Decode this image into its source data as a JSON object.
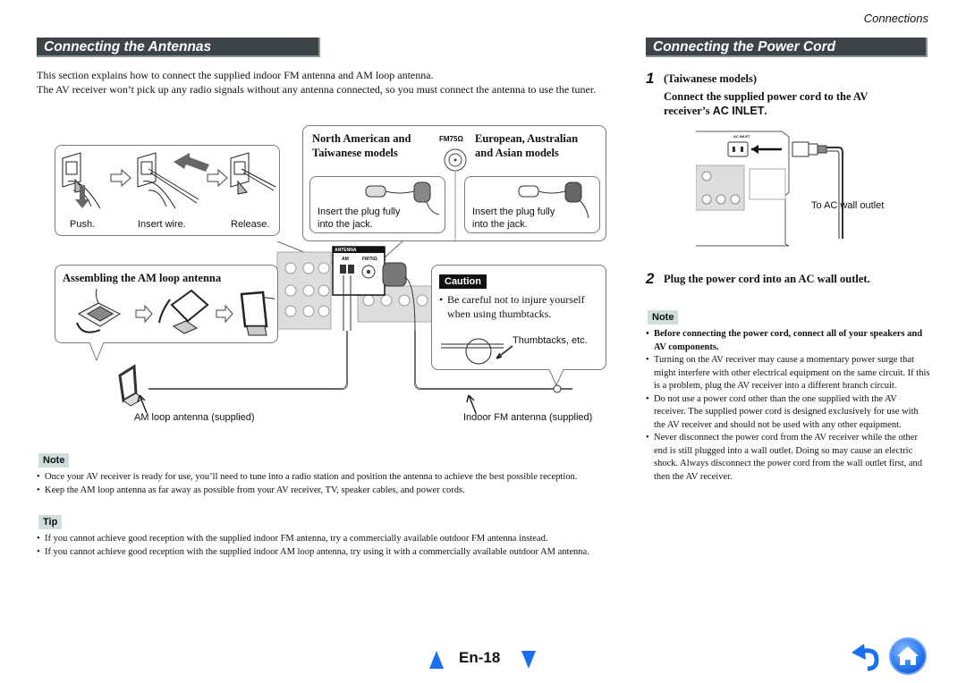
{
  "running_head": "Connections",
  "antennas": {
    "title": "Connecting the Antennas",
    "intro": [
      "This section explains how to connect the supplied indoor FM antenna and AM loop antenna.",
      "The AV receiver won’t pick up any radio signals without any antenna connected, so you must connect the antenna to use the tuner."
    ],
    "am_terminal_steps": [
      "Push.",
      "Insert wire.",
      "Release."
    ],
    "fm_jack_label": "FM75Ω",
    "region_left": {
      "title_line1": "North American and",
      "title_line2": "Taiwanese models",
      "instruction_line1": "Insert the plug fully",
      "instruction_line2": "into the jack."
    },
    "region_right": {
      "title_line1": "European, Australian",
      "title_line2": "and Asian models",
      "instruction_line1": "Insert the plug fully",
      "instruction_line2": "into the jack."
    },
    "receiver_panel": {
      "antenna_label": "ANTENNA",
      "am_label": "AM",
      "fm_label": "FM75Ω"
    },
    "am_assembly_title": "Assembling the AM loop antenna",
    "caution": {
      "tag": "Caution",
      "bullet_line1": "Be careful not to injure yourself",
      "bullet_line2": "when using thumbtacks.",
      "thumbtack_label": "Thumbtacks, etc."
    },
    "am_antenna_label": "AM loop antenna (supplied)",
    "fm_antenna_label": "Indoor FM antenna (supplied)",
    "note": {
      "tag": "Note",
      "items": [
        "Once your AV receiver is ready for use, you’ll need to tune into a radio station and position the antenna to achieve the best possible reception.",
        "Keep the AM loop antenna as far away as possible from your AV receiver, TV, speaker cables, and power cords."
      ]
    },
    "tip": {
      "tag": "Tip",
      "items": [
        "If you cannot achieve good reception with the supplied indoor FM antenna, try a commercially available outdoor FM antenna instead.",
        "If you cannot achieve good reception with the supplied indoor AM loop antenna, try using it with a commercially available outdoor AM antenna."
      ]
    }
  },
  "power": {
    "title": "Connecting the Power Cord",
    "step1": {
      "num": "1",
      "models": "(Taiwanese models)",
      "text_a": "Connect the supplied power cord to the AV receiver’s ",
      "text_b": "AC INLET",
      "text_c": "."
    },
    "ac_inlet_label": "AC INLET",
    "outlet_label": "To AC wall outlet",
    "step2": {
      "num": "2",
      "text": "Plug the power cord into an AC wall outlet."
    },
    "note": {
      "tag": "Note",
      "items": [
        "Before connecting the power cord, connect all of your speakers and AV components.",
        "Turning on the AV receiver may cause a momentary power surge that might interfere with other electrical equipment on the same circuit. If this is a problem, plug the AV receiver into a different branch circuit.",
        "Do not use a power cord other than the one supplied with the AV receiver. The supplied power cord is designed exclusively for use with the AV receiver and should not be used with any other equipment.",
        "Never disconnect the power cord from the AV receiver while the other end is still plugged into a wall outlet. Doing so may cause an electric shock. Always disconnect the power cord from the wall outlet first, and then the AV receiver."
      ]
    }
  },
  "footer": {
    "page": "En-18",
    "nav_color": "#1a6ff0"
  }
}
